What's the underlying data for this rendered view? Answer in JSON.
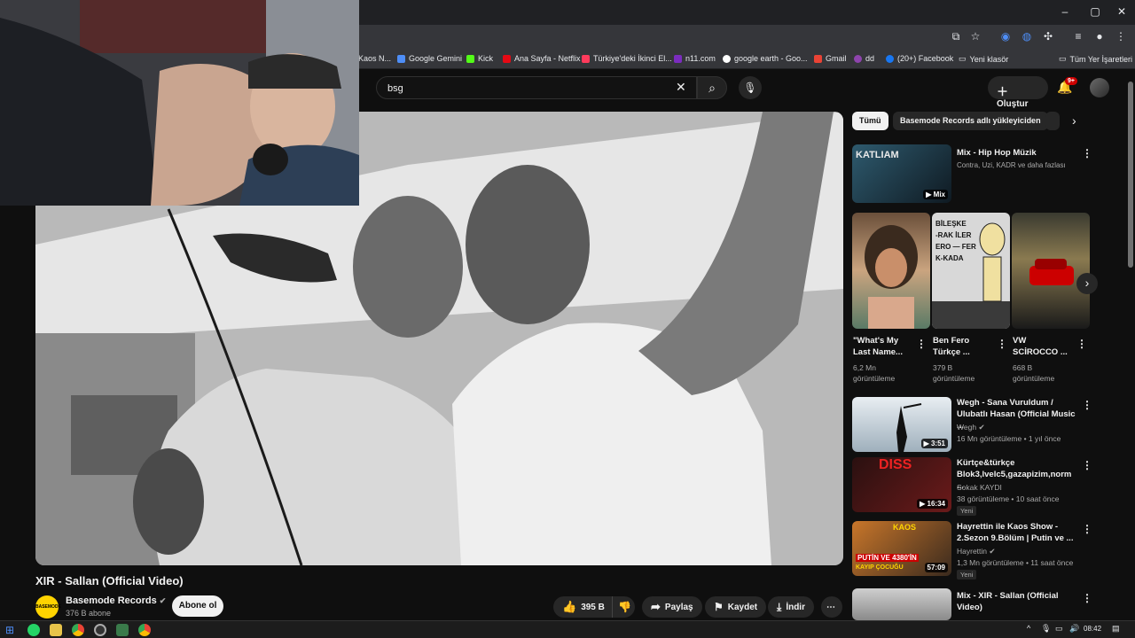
{
  "browser": {
    "window_controls": [
      "–",
      "▢",
      "✕"
    ],
    "bookmarks": [
      {
        "label": "Kaos N...",
        "color": "#9e9e9e"
      },
      {
        "label": "Google Gemini",
        "color": "#4e8ef7"
      },
      {
        "label": "Kick",
        "color": "#53fc18"
      },
      {
        "label": "Ana Sayfa - Netflix",
        "color": "#e50914"
      },
      {
        "label": "Türkiye'deki İkinci El...",
        "color": "#ff3b5c"
      },
      {
        "label": "n11.com",
        "color": "#7b2cbf"
      },
      {
        "label": "google earth - Goo...",
        "color": "#ffffff"
      },
      {
        "label": "Gmail",
        "color": "#ea4335"
      },
      {
        "label": "dd",
        "color": "#8e44ad"
      },
      {
        "label": "(20+) Facebook",
        "color": "#1877f2"
      },
      {
        "label": "Yeni klasör",
        "color": "#e8eaed"
      }
    ],
    "all_bookmarks": "Tüm Yer İşaretleri"
  },
  "header": {
    "search_value": "bsg",
    "create_label": "Oluştur",
    "notifications_badge": "9+"
  },
  "video": {
    "title": "XIR - Sallan (Official Video)",
    "channel": "Basemode Records",
    "channel_logo_text": "BASEMODE",
    "subscribers": "376 B abone",
    "subscribe_label": "Abone ol",
    "likes": "395 B",
    "share_label": "Paylaş",
    "save_label": "Kaydet",
    "download_label": "İndir"
  },
  "chips": [
    "Tümü",
    "Basemode Records adlı yükleyiciden"
  ],
  "mix_top": {
    "title": "Mix - Hip Hop Müzik",
    "meta": "Contra, Uzi, KADR ve daha fazlası",
    "badge": "Mix",
    "thumb_text": "KATLIAM"
  },
  "shorts": [
    {
      "title1": "\"What's My",
      "title2": "Last Name...",
      "views1": "6,2 Mn",
      "views2": "görüntüleme"
    },
    {
      "title1": "Ben Fero",
      "title2": "Türkçe ...",
      "views1": "379 B",
      "views2": "görüntüleme"
    },
    {
      "title1": "VW",
      "title2": "SCİROCCO ...",
      "views1": "668 B",
      "views2": "görüntüleme"
    }
  ],
  "short_board_text": [
    "BİLEŞKE",
    "-RAK İLER",
    "ERO — FER",
    "K-KADA"
  ],
  "recs": [
    {
      "title1": "Wegh -  Sana Vuruldum /",
      "title2": "Ulubatlı Hasan (Official Music ...",
      "channel": "Wegh",
      "meta": "16 Mn görüntüleme • 1 yıl önce",
      "duration": "3:51",
      "badge": ""
    },
    {
      "title1": "Kürtçe&türkçe",
      "title2": "Blok3,lvelc5,gazapizim,norm ...",
      "channel": "Sokak KAYDI",
      "meta": "38 görüntüleme • 10 saat önce",
      "duration": "16:34",
      "badge": "Yeni",
      "thumb_text": "DISS"
    },
    {
      "title1": "Hayrettin ile Kaos Show -",
      "title2": "2.Sezon 9.Bölüm | Putin ve ...",
      "channel": "Hayrettin",
      "meta": "1,3 Mn görüntüleme • 11 saat önce",
      "duration": "57:09",
      "badge": "Yeni",
      "thumb_text1": "PUTİN VE 4380'İN",
      "thumb_text2": "KAYIP ÇOCUĞU",
      "thumb_text3": "KAOS"
    },
    {
      "title1": "Mix - XIR - Sallan (Official",
      "title2": "Video)",
      "channel": "",
      "meta": "",
      "duration": "",
      "badge": ""
    }
  ],
  "taskbar": {
    "time": "08:42"
  },
  "colors": {
    "bg": "#0f0f0f",
    "accent_red": "#cc0000",
    "chip_active": "#f1f1f1"
  }
}
